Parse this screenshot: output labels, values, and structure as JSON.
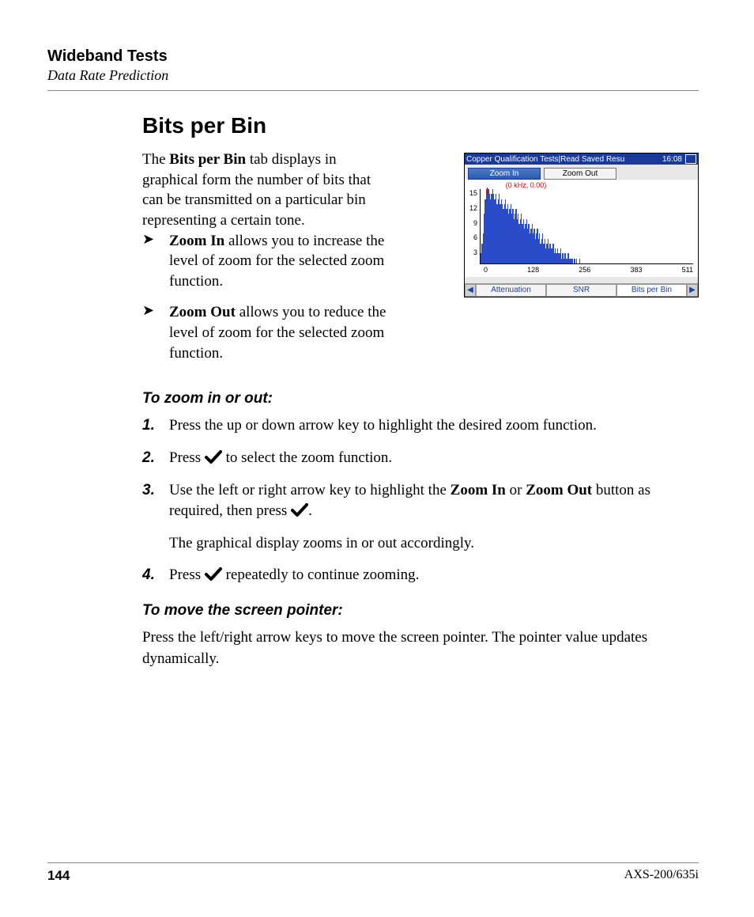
{
  "header": {
    "title": "Wideband Tests",
    "subtitle": "Data Rate Prediction"
  },
  "section_title": "Bits per Bin",
  "intro": {
    "pre": "The ",
    "bold": "Bits per Bin",
    "post": " tab displays in graphical form the number of bits that can be transmitted on a particular bin representing a certain tone."
  },
  "bullets": [
    {
      "bold": "Zoom In",
      "rest": " allows you to increase the level of zoom for the selected zoom function."
    },
    {
      "bold": "Zoom Out",
      "rest": " allows you to reduce the level of zoom for the selected zoom function."
    }
  ],
  "subhead1": "To zoom in or out:",
  "steps": [
    {
      "n": "1.",
      "pre": "Press the up or down arrow key to highlight the desired zoom function."
    },
    {
      "n": "2.",
      "pre": "Press ",
      "check": true,
      "post": " to select the zoom function."
    },
    {
      "n": "3.",
      "pre": "Use the left or right arrow key to highlight the ",
      "bold1": "Zoom In",
      "mid": " or ",
      "bold2": "Zoom Out",
      "post_pre_check": " button as required, then press ",
      "check": true,
      "post": ".",
      "tail": "The graphical display zooms in or out accordingly."
    },
    {
      "n": "4.",
      "pre": "Press ",
      "check": true,
      "post": " repeatedly to continue zooming."
    }
  ],
  "subhead2": "To move the screen pointer:",
  "pointer_para": "Press the left/right arrow keys to move the screen pointer. The pointer value updates dynamically.",
  "device": {
    "titlebar": "Copper Qualification Tests|Read Saved Resu",
    "time": "16:08",
    "zoom_in": "Zoom In",
    "zoom_out": "Zoom Out",
    "cursor_label": "(0 kHz, 0.00)",
    "tabs": {
      "left_arrow": "◀",
      "attenuation": "Attenuation",
      "snr": "SNR",
      "bits": "Bits per Bin",
      "right_arrow": "▶"
    }
  },
  "chart_data": {
    "type": "bar",
    "title": "",
    "xlabel": "",
    "ylabel": "",
    "xlim": [
      0,
      511
    ],
    "ylim": [
      0,
      15
    ],
    "xticks": [
      0,
      128,
      256,
      383,
      511
    ],
    "yticks": [
      3,
      6,
      9,
      12,
      15
    ],
    "cursor": {
      "x_khz": 0,
      "y": 0.0
    },
    "categories_note": "x = bin index 0..511; bars shown roughly 0..150",
    "values": [
      2,
      4,
      6,
      10,
      13,
      15,
      14,
      15,
      14,
      13,
      14,
      15,
      14,
      13,
      14,
      12,
      13,
      14,
      12,
      13,
      12,
      11,
      12,
      13,
      11,
      12,
      10,
      11,
      12,
      10,
      11,
      9,
      10,
      11,
      9,
      10,
      8,
      9,
      10,
      8,
      9,
      7,
      8,
      9,
      7,
      8,
      6,
      7,
      8,
      6,
      7,
      5,
      6,
      7,
      5,
      6,
      4,
      5,
      6,
      4,
      5,
      3,
      4,
      5,
      3,
      4,
      3,
      3,
      4,
      2,
      3,
      2,
      3,
      2,
      2,
      3,
      1,
      2,
      1,
      2,
      1,
      1,
      2,
      1,
      1,
      1,
      1,
      0,
      1,
      0,
      1,
      0,
      0,
      1,
      0,
      0,
      0,
      0,
      0,
      0
    ]
  },
  "footer": {
    "page": "144",
    "model": "AXS-200/635i"
  }
}
